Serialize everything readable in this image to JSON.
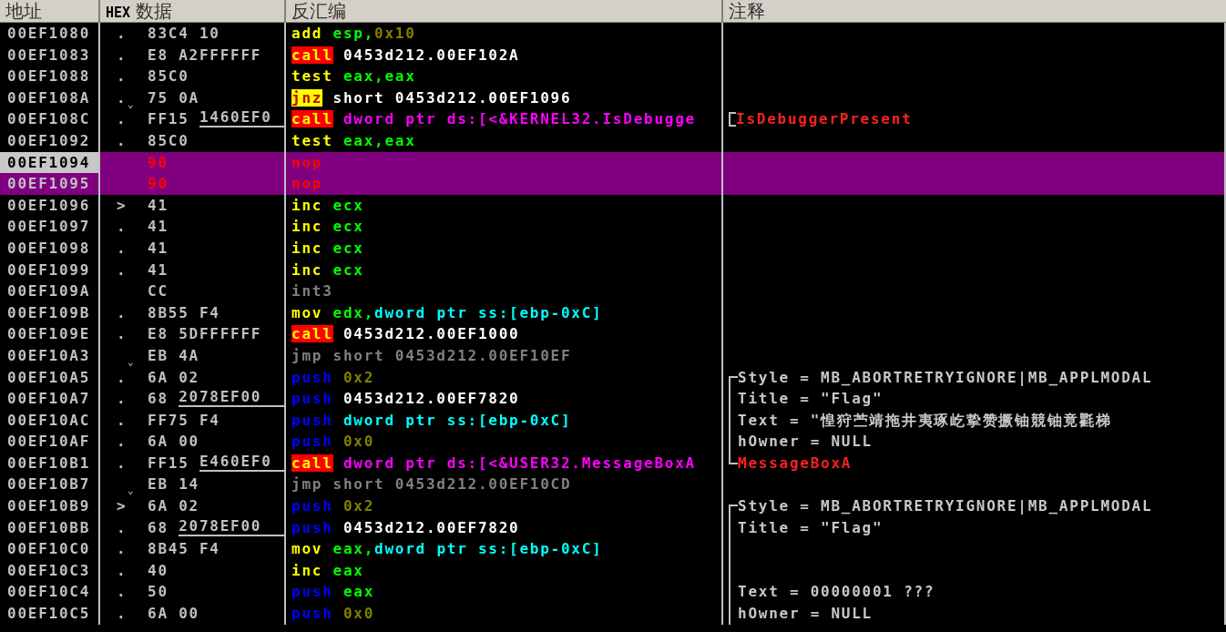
{
  "columns": [
    {
      "label": "地址"
    },
    {
      "label": "**HEX** 数据"
    },
    {
      "label": "反汇编"
    },
    {
      "label": "注释"
    }
  ],
  "rows": [
    {
      "address": "00EF1080",
      "selected": false,
      "cursor": false,
      "marker": ".",
      "hex": [
        {
          "text": "83C4 10",
          "fixup": false
        }
      ],
      "code": [
        {
          "kind": "mnemonic",
          "text": "add"
        },
        {
          "kind": "register",
          "text": " esp,"
        },
        {
          "kind": "immediate",
          "text": "0x10"
        }
      ]
    },
    {
      "address": "00EF1083",
      "selected": false,
      "cursor": false,
      "marker": ".",
      "hex": [
        {
          "text": "E8 A2FFFFFF",
          "fixup": false
        }
      ],
      "code": [
        {
          "kind": "call",
          "text": "call"
        },
        {
          "kind": "address",
          "text": " 0453d212.00EF102A"
        }
      ]
    },
    {
      "address": "00EF1088",
      "selected": false,
      "cursor": false,
      "marker": ".",
      "hex": [
        {
          "text": "85C0",
          "fixup": false
        }
      ],
      "code": [
        {
          "kind": "mnemonic",
          "text": "test"
        },
        {
          "kind": "register",
          "text": " eax,eax"
        }
      ]
    },
    {
      "address": "00EF108A",
      "selected": false,
      "cursor": false,
      "marker": ".",
      "jump": "⌄",
      "hex": [
        {
          "text": "75 0A",
          "fixup": false
        }
      ],
      "code": [
        {
          "kind": "jcc",
          "text": "jnz"
        },
        {
          "kind": "address",
          "text": " short 0453d212.00EF1096"
        }
      ]
    },
    {
      "address": "00EF108C",
      "selected": false,
      "cursor": false,
      "marker": ".",
      "hex": [
        {
          "text": "FF15 ",
          "fixup": false
        },
        {
          "text": "1460EF0",
          "fixup": true
        }
      ],
      "code": [
        {
          "kind": "call",
          "text": "call"
        },
        {
          "kind": "import",
          "text": " dword ptr ds:[<&KERNEL32.IsDebugge"
        }
      ],
      "bracket": {
        "kind": "single"
      },
      "comment": {
        "kind": "api",
        "text": "IsDebuggerPresent"
      }
    },
    {
      "address": "00EF1092",
      "selected": false,
      "cursor": false,
      "marker": ".",
      "hex": [
        {
          "text": "85C0",
          "fixup": false
        }
      ],
      "code": [
        {
          "kind": "mnemonic",
          "text": "test"
        },
        {
          "kind": "register",
          "text": " eax,eax"
        }
      ]
    },
    {
      "address": "00EF1094",
      "selected": true,
      "cursor": true,
      "hex": [
        {
          "text": "90",
          "fixup": false
        }
      ],
      "code": [
        {
          "kind": "nop",
          "text": "nop"
        }
      ]
    },
    {
      "address": "00EF1095",
      "selected": true,
      "cursor": false,
      "hex": [
        {
          "text": "90",
          "fixup": false
        }
      ],
      "code": [
        {
          "kind": "nop",
          "text": "nop"
        }
      ]
    },
    {
      "address": "00EF1096",
      "selected": false,
      "cursor": false,
      "marker": ">",
      "hex": [
        {
          "text": "41",
          "fixup": false
        }
      ],
      "code": [
        {
          "kind": "mnemonic",
          "text": "inc"
        },
        {
          "kind": "register",
          "text": " ecx"
        }
      ]
    },
    {
      "address": "00EF1097",
      "selected": false,
      "cursor": false,
      "marker": ".",
      "hex": [
        {
          "text": "41",
          "fixup": false
        }
      ],
      "code": [
        {
          "kind": "mnemonic",
          "text": "inc"
        },
        {
          "kind": "register",
          "text": " ecx"
        }
      ]
    },
    {
      "address": "00EF1098",
      "selected": false,
      "cursor": false,
      "marker": ".",
      "hex": [
        {
          "text": "41",
          "fixup": false
        }
      ],
      "code": [
        {
          "kind": "mnemonic",
          "text": "inc"
        },
        {
          "kind": "register",
          "text": " ecx"
        }
      ]
    },
    {
      "address": "00EF1099",
      "selected": false,
      "cursor": false,
      "marker": ".",
      "hex": [
        {
          "text": "41",
          "fixup": false
        }
      ],
      "code": [
        {
          "kind": "mnemonic",
          "text": "inc"
        },
        {
          "kind": "register",
          "text": " ecx"
        }
      ]
    },
    {
      "address": "00EF109A",
      "selected": false,
      "cursor": false,
      "hex": [
        {
          "text": "CC",
          "fixup": false
        }
      ],
      "code": [
        {
          "kind": "dim",
          "text": "int3"
        }
      ]
    },
    {
      "address": "00EF109B",
      "selected": false,
      "cursor": false,
      "marker": ".",
      "hex": [
        {
          "text": "8B55 F4",
          "fixup": false
        }
      ],
      "code": [
        {
          "kind": "mnemonic",
          "text": "mov"
        },
        {
          "kind": "register",
          "text": " edx,"
        },
        {
          "kind": "memory",
          "text": "dword ptr ss:[ebp-0xC]"
        }
      ]
    },
    {
      "address": "00EF109E",
      "selected": false,
      "cursor": false,
      "marker": ".",
      "hex": [
        {
          "text": "E8 5DFFFFFF",
          "fixup": false
        }
      ],
      "code": [
        {
          "kind": "call",
          "text": "call"
        },
        {
          "kind": "address",
          "text": " 0453d212.00EF1000"
        }
      ]
    },
    {
      "address": "00EF10A3",
      "selected": false,
      "cursor": false,
      "jump": "⌄",
      "hex": [
        {
          "text": "EB 4A",
          "fixup": false
        }
      ],
      "code": [
        {
          "kind": "dim",
          "text": "jmp short 0453d212.00EF10EF"
        }
      ]
    },
    {
      "address": "00EF10A5",
      "selected": false,
      "cursor": false,
      "marker": ".",
      "hex": [
        {
          "text": "6A 02",
          "fixup": false
        }
      ],
      "code": [
        {
          "kind": "push",
          "text": "push"
        },
        {
          "kind": "immediate",
          "text": " 0x2"
        }
      ],
      "bracket": {
        "kind": "top"
      },
      "comment": {
        "kind": "plain",
        "text": "Style = MB_ABORTRETRYIGNORE|MB_APPLMODAL"
      }
    },
    {
      "address": "00EF10A7",
      "selected": false,
      "cursor": false,
      "marker": ".",
      "hex": [
        {
          "text": "68 ",
          "fixup": false
        },
        {
          "text": "2078EF00",
          "fixup": true
        }
      ],
      "code": [
        {
          "kind": "push",
          "text": "push"
        },
        {
          "kind": "address",
          "text": " 0453d212.00EF7820"
        }
      ],
      "bracket": {
        "kind": "middle"
      },
      "comment": {
        "kind": "plain",
        "text": "Title = \"Flag\""
      }
    },
    {
      "address": "00EF10AC",
      "selected": false,
      "cursor": false,
      "marker": ".",
      "hex": [
        {
          "text": "FF75 F4",
          "fixup": false
        }
      ],
      "code": [
        {
          "kind": "push",
          "text": "push"
        },
        {
          "kind": "memory",
          "text": " dword ptr ss:[ebp-0xC]"
        }
      ],
      "bracket": {
        "kind": "middle"
      },
      "comment": {
        "kind": "plain",
        "text": "Text = \"惶狩苎靖拖井夷琢屹挚赞撅铀競铀竟氍梯"
      }
    },
    {
      "address": "00EF10AF",
      "selected": false,
      "cursor": false,
      "marker": ".",
      "hex": [
        {
          "text": "6A 00",
          "fixup": false
        }
      ],
      "code": [
        {
          "kind": "push",
          "text": "push"
        },
        {
          "kind": "immediate",
          "text": " 0x0"
        }
      ],
      "bracket": {
        "kind": "middle"
      },
      "comment": {
        "kind": "plain",
        "text": "hOwner = NULL"
      }
    },
    {
      "address": "00EF10B1",
      "selected": false,
      "cursor": false,
      "marker": ".",
      "hex": [
        {
          "text": "FF15 ",
          "fixup": false
        },
        {
          "text": "E460EF0",
          "fixup": true
        }
      ],
      "code": [
        {
          "kind": "call",
          "text": "call"
        },
        {
          "kind": "import",
          "text": " dword ptr ds:[<&USER32.MessageBoxA"
        }
      ],
      "bracket": {
        "kind": "bottom"
      },
      "comment": {
        "kind": "api",
        "text": "MessageBoxA"
      }
    },
    {
      "address": "00EF10B7",
      "selected": false,
      "cursor": false,
      "jump": "⌄",
      "hex": [
        {
          "text": "EB 14",
          "fixup": false
        }
      ],
      "code": [
        {
          "kind": "dim",
          "text": "jmp short 0453d212.00EF10CD"
        }
      ]
    },
    {
      "address": "00EF10B9",
      "selected": false,
      "cursor": false,
      "marker": ">",
      "hex": [
        {
          "text": "6A 02",
          "fixup": false
        }
      ],
      "code": [
        {
          "kind": "push",
          "text": "push"
        },
        {
          "kind": "immediate",
          "text": " 0x2"
        }
      ],
      "bracket": {
        "kind": "top"
      },
      "comment": {
        "kind": "plain",
        "text": "Style = MB_ABORTRETRYIGNORE|MB_APPLMODAL"
      }
    },
    {
      "address": "00EF10BB",
      "selected": false,
      "cursor": false,
      "marker": ".",
      "hex": [
        {
          "text": "68 ",
          "fixup": false
        },
        {
          "text": "2078EF00",
          "fixup": true
        }
      ],
      "code": [
        {
          "kind": "push",
          "text": "push"
        },
        {
          "kind": "address",
          "text": " 0453d212.00EF7820"
        }
      ],
      "bracket": {
        "kind": "middle"
      },
      "comment": {
        "kind": "plain",
        "text": "Title = \"Flag\""
      }
    },
    {
      "address": "00EF10C0",
      "selected": false,
      "cursor": false,
      "marker": ".",
      "hex": [
        {
          "text": "8B45 F4",
          "fixup": false
        }
      ],
      "code": [
        {
          "kind": "mnemonic",
          "text": "mov"
        },
        {
          "kind": "register",
          "text": " eax,"
        },
        {
          "kind": "memory",
          "text": "dword ptr ss:[ebp-0xC]"
        }
      ],
      "bracket": {
        "kind": "middle"
      }
    },
    {
      "address": "00EF10C3",
      "selected": false,
      "cursor": false,
      "marker": ".",
      "hex": [
        {
          "text": "40",
          "fixup": false
        }
      ],
      "code": [
        {
          "kind": "mnemonic",
          "text": "inc"
        },
        {
          "kind": "register",
          "text": " eax"
        }
      ],
      "bracket": {
        "kind": "middle"
      }
    },
    {
      "address": "00EF10C4",
      "selected": false,
      "cursor": false,
      "marker": ".",
      "hex": [
        {
          "text": "50",
          "fixup": false
        }
      ],
      "code": [
        {
          "kind": "push",
          "text": "push"
        },
        {
          "kind": "register",
          "text": " eax"
        }
      ],
      "bracket": {
        "kind": "middle"
      },
      "comment": {
        "kind": "plain",
        "text": "Text = 00000001 ???"
      }
    },
    {
      "address": "00EF10C5",
      "selected": false,
      "cursor": false,
      "marker": ".",
      "hex": [
        {
          "text": "6A 00",
          "fixup": false
        }
      ],
      "code": [
        {
          "kind": "push",
          "text": "push"
        },
        {
          "kind": "immediate",
          "text": " 0x0"
        }
      ],
      "bracket": {
        "kind": "middle"
      },
      "comment": {
        "kind": "plain",
        "text": "hOwner = NULL"
      }
    }
  ]
}
